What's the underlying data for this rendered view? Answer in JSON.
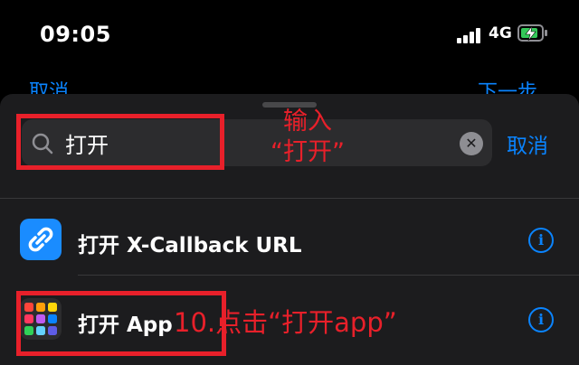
{
  "status": {
    "time": "09:05",
    "network": "4G"
  },
  "behind": {
    "left_label": "取消",
    "right_label": "下一步"
  },
  "search": {
    "value": "打开",
    "placeholder": "",
    "clear_icon": "clear-icon",
    "cancel_label": "取消"
  },
  "annotations": {
    "step_input": "输入\n“打开”",
    "step_10": "10.点击“打开app”"
  },
  "results": [
    {
      "title": "打开 X-Callback URL",
      "icon": "link-icon",
      "icon_color": "#1a8cff"
    },
    {
      "title": "打开 App",
      "icon": "app-grid-icon",
      "icon_color": "#2c2c2e"
    }
  ],
  "colors": {
    "accent": "#0a84ff",
    "annotation": "#e8202a",
    "sheet": "#1c1c1e"
  }
}
